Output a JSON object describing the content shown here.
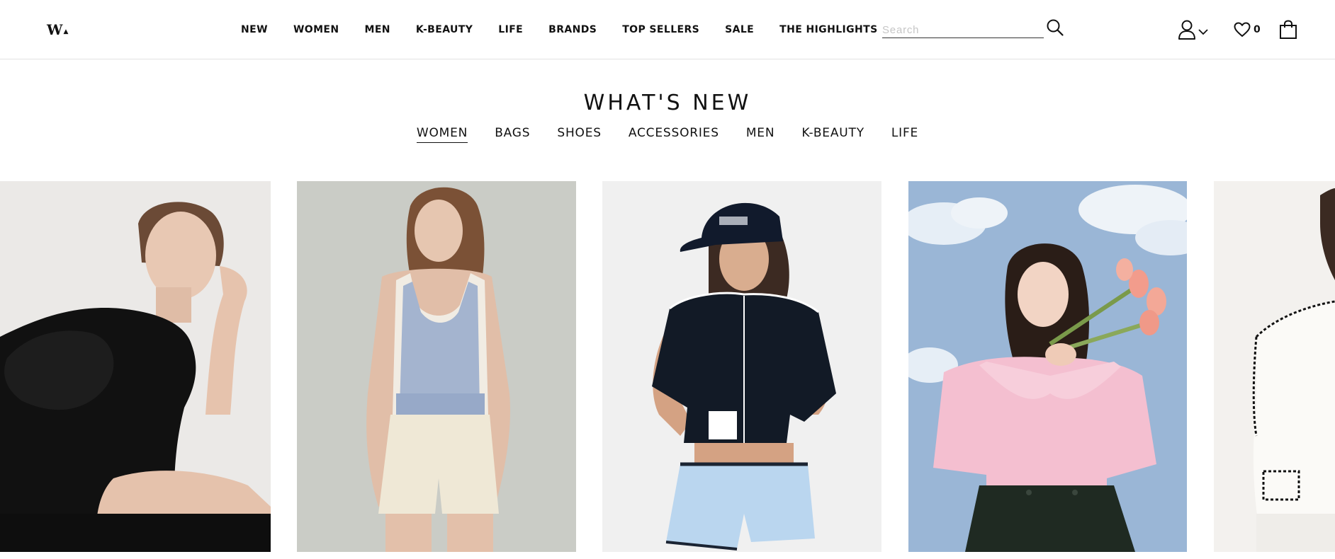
{
  "header": {
    "logo_text": "W",
    "logo_mark": "▲",
    "nav": [
      "NEW",
      "WOMEN",
      "MEN",
      "K-BEAUTY",
      "LIFE",
      "BRANDS",
      "TOP SELLERS",
      "SALE",
      "THE HIGHLIGHTS"
    ],
    "search": {
      "placeholder": "Search",
      "value": ""
    },
    "wishlist_count": "0",
    "icons": [
      "search-icon",
      "user-icon",
      "chevron-down-icon",
      "heart-icon",
      "shopping-bag-icon"
    ]
  },
  "section": {
    "title": "WHAT'S NEW",
    "tabs": [
      "WOMEN",
      "BAGS",
      "SHOES",
      "ACCESSORIES",
      "MEN",
      "K-BEAUTY",
      "LIFE"
    ],
    "active_tab": "WOMEN"
  },
  "products": [
    {
      "name": "product-card-black-ruffle-top",
      "bg": "#ebe9e7"
    },
    {
      "name": "product-card-blue-knit-tank",
      "bg": "#c6c8c2"
    },
    {
      "name": "product-card-navy-puff-sleeve-top",
      "bg": "#f0f0f0"
    },
    {
      "name": "product-card-pink-ruffle-blouse",
      "bg": "#9ab6d6"
    },
    {
      "name": "product-card-white-tweed-jacket",
      "bg": "#f3f1ee"
    }
  ]
}
